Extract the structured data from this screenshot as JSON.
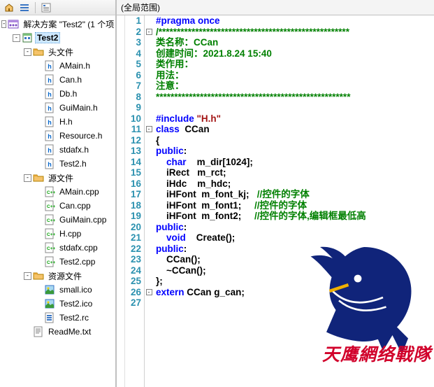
{
  "toolbar_icons": [
    "home-icon",
    "rows-icon",
    "properties-icon"
  ],
  "solution": {
    "label": "解决方案 \"Test2\" (1 个项",
    "project": "Test2",
    "folders": [
      {
        "name": "头文件",
        "files": [
          "AMain.h",
          "Can.h",
          "Db.h",
          "GuiMain.h",
          "H.h",
          "Resource.h",
          "stdafx.h",
          "Test2.h"
        ]
      },
      {
        "name": "源文件",
        "files": [
          "AMain.cpp",
          "Can.cpp",
          "GuiMain.cpp",
          "H.cpp",
          "stdafx.cpp",
          "Test2.cpp"
        ]
      },
      {
        "name": "资源文件",
        "files": [
          "small.ico",
          "Test2.ico",
          "Test2.rc"
        ]
      }
    ],
    "loose_file": "ReadMe.txt"
  },
  "breadcrumb": "(全局范围)",
  "code_lines": [
    {
      "n": 1,
      "fold": "",
      "html": "<span class='pp'>#pragma once</span>"
    },
    {
      "n": 2,
      "fold": "minus",
      "html": "<span class='cm'>/****************************************************</span>"
    },
    {
      "n": 3,
      "fold": "",
      "html": "<span class='cm'>类名称：CCan</span>"
    },
    {
      "n": 4,
      "fold": "",
      "html": "<span class='cm'>创建时间：2021.8.24 15:40</span>"
    },
    {
      "n": 5,
      "fold": "",
      "html": "<span class='cm'>类作用：</span>"
    },
    {
      "n": 6,
      "fold": "",
      "html": "<span class='cm'>用法：</span>"
    },
    {
      "n": 7,
      "fold": "",
      "html": "<span class='cm'>注意：</span>"
    },
    {
      "n": 8,
      "fold": "",
      "html": "<span class='cm'>*****************************************************</span>"
    },
    {
      "n": 9,
      "fold": "",
      "html": ""
    },
    {
      "n": 10,
      "fold": "",
      "html": "<span class='pp'>#include</span> <span class='str'>\"H.h\"</span>"
    },
    {
      "n": 11,
      "fold": "minus",
      "html": "<span class='kw'>class</span>  <span class='id'>CCan</span>"
    },
    {
      "n": 12,
      "fold": "",
      "html": "<span class='pn'>{</span>"
    },
    {
      "n": 13,
      "fold": "",
      "html": "<span class='kw'>public</span><span class='pn'>:</span>"
    },
    {
      "n": 14,
      "fold": "",
      "html": "    <span class='kw'>char</span>    <span class='id'>m_dir[1024];</span>"
    },
    {
      "n": 15,
      "fold": "",
      "html": "    <span class='id'>iRect   m_rct;</span>"
    },
    {
      "n": 16,
      "fold": "",
      "html": "    <span class='id'>iHdc    m_hdc;</span>"
    },
    {
      "n": 17,
      "fold": "",
      "html": "    <span class='id'>iHFont  m_font_kj;</span>   <span class='cm'>//控件的字体</span>"
    },
    {
      "n": 18,
      "fold": "",
      "html": "    <span class='id'>iHFont  m_font1;</span>     <span class='cm'>//控件的字体</span>"
    },
    {
      "n": 19,
      "fold": "",
      "html": "    <span class='id'>iHFont  m_font2;</span>     <span class='cm'>//控件的字体,编辑框最低高</span>"
    },
    {
      "n": 20,
      "fold": "",
      "html": "<span class='kw'>public</span><span class='pn'>:</span>"
    },
    {
      "n": 21,
      "fold": "",
      "html": "    <span class='kw'>void</span>    <span class='id'>Create();</span>"
    },
    {
      "n": 22,
      "fold": "",
      "html": "<span class='kw'>public</span><span class='pn'>:</span>"
    },
    {
      "n": 23,
      "fold": "",
      "html": "    <span class='id'>CCan();</span>"
    },
    {
      "n": 24,
      "fold": "",
      "html": "    <span class='id'>~CCan();</span>"
    },
    {
      "n": 25,
      "fold": "",
      "html": "<span class='pn'>};</span>"
    },
    {
      "n": 26,
      "fold": "minus",
      "html": "<span class='kw'>extern</span> <span class='id'>CCan g_can;</span>"
    },
    {
      "n": 27,
      "fold": "",
      "html": ""
    }
  ],
  "watermark_text": "天鹰網络戰隊"
}
